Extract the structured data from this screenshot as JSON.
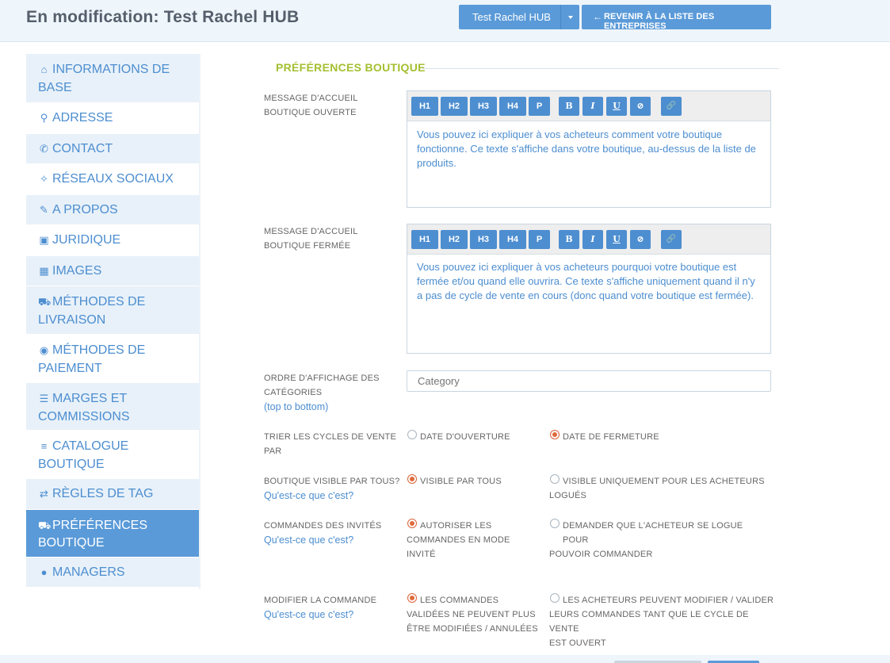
{
  "header": {
    "title": "En modification: Test Rachel HUB",
    "hub_select": "Test Rachel HUB",
    "back_label": "REVENIR À LA LISTE DES ENTREPRISES"
  },
  "sidebar": {
    "items": [
      {
        "label": "INFORMATIONS DE BASE",
        "icon": "home-icon"
      },
      {
        "label": "ADRESSE",
        "icon": "map-marker-icon"
      },
      {
        "label": "CONTACT",
        "icon": "phone-icon"
      },
      {
        "label": "RÉSEAUX SOCIAUX",
        "icon": "twitter-icon"
      },
      {
        "label": "A PROPOS",
        "icon": "pencil-icon"
      },
      {
        "label": "JURIDIQUE",
        "icon": "briefcase-icon"
      },
      {
        "label": "IMAGES",
        "icon": "picture-icon"
      },
      {
        "label": "MÉTHODES DE LIVRAISON",
        "icon": "truck-icon"
      },
      {
        "label": "MÉTHODES DE PAIEMENT",
        "icon": "money-icon"
      },
      {
        "label": "MARGES ET COMMISSIONS",
        "icon": "list-icon"
      },
      {
        "label": "CATALOGUE BOUTIQUE",
        "icon": "list-ul-icon"
      },
      {
        "label": "RÈGLES DE TAG",
        "icon": "random-icon"
      },
      {
        "label": "PRÉFÉRENCES BOUTIQUE",
        "icon": "cart-icon"
      },
      {
        "label": "MANAGERS",
        "icon": "user-icon"
      }
    ],
    "active_index": 12
  },
  "main": {
    "section_title": "PRÉFÉRENCES BOUTIQUE",
    "toolbar": [
      "H1",
      "H2",
      "H3",
      "H4",
      "P",
      "B",
      "I",
      "U",
      "⊘",
      "🔗"
    ],
    "open_msg": {
      "label_line1": "MESSAGE D'ACCUEIL",
      "label_line2": "BOUTIQUE OUVERTE",
      "text": "Vous pouvez ici expliquer à vos acheteurs comment votre boutique fonctionne. Ce texte s'affiche dans votre boutique, au-dessus de la liste de produits."
    },
    "closed_msg": {
      "label_line1": "MESSAGE D'ACCUEIL",
      "label_line2": "BOUTIQUE FERMÉE",
      "text": "Vous pouvez ici expliquer à vos acheteurs pourquoi votre boutique est fermée et/ou quand elle ouvrira. Ce texte s'affiche uniquement quand il n'y a pas de cycle de vente en cours (donc quand votre boutique est fermée)."
    },
    "category_order": {
      "label_line1": "ORDRE D'AFFICHAGE DES",
      "label_line2": "CATÉGORIES",
      "sub": "(top to bottom)",
      "placeholder": "Category"
    },
    "sort_cycles": {
      "label_line1": "TRIER LES CYCLES DE VENTE",
      "label_line2": "PAR",
      "option1": "DATE D'OUVERTURE",
      "option2": "DATE DE FERMETURE",
      "selected": 2
    },
    "visible": {
      "label": "BOUTIQUE VISIBLE PAR TOUS?",
      "help": "Qu'est-ce que c'est?",
      "option1": "VISIBLE PAR TOUS",
      "option2_line1": "VISIBLE UNIQUEMENT POUR LES ACHETEURS",
      "option2_line2": "LOGUÉS",
      "selected": 1
    },
    "guest_orders": {
      "label": "COMMANDES DES INVITÉS",
      "help": "Qu'est-ce que c'est?",
      "option1_line1": "AUTORISER LES",
      "option1_line2": "COMMANDES EN MODE",
      "option1_line3": "INVITÉ",
      "option2_line1": "DEMANDER QUE L'ACHETEUR SE LOGUE POUR",
      "option2_line2": "POUVOIR COMMANDER",
      "selected": 1
    },
    "modify_order": {
      "label": "MODIFIER LA COMMANDE",
      "help": "Qu'est-ce que c'est?",
      "option1_line1": "LES COMMANDES",
      "option1_line2": "VALIDÉES NE PEUVENT PLUS",
      "option1_line3": "ÊTRE MODIFIÉES / ANNULÉES",
      "option2_line1": "LES ACHETEURS PEUVENT MODIFIER / VALIDER",
      "option2_line2": "LEURS COMMANDES TANT QUE LE CYCLE DE VENTE",
      "option2_line3": "EST OUVERT",
      "selected": 1
    }
  }
}
